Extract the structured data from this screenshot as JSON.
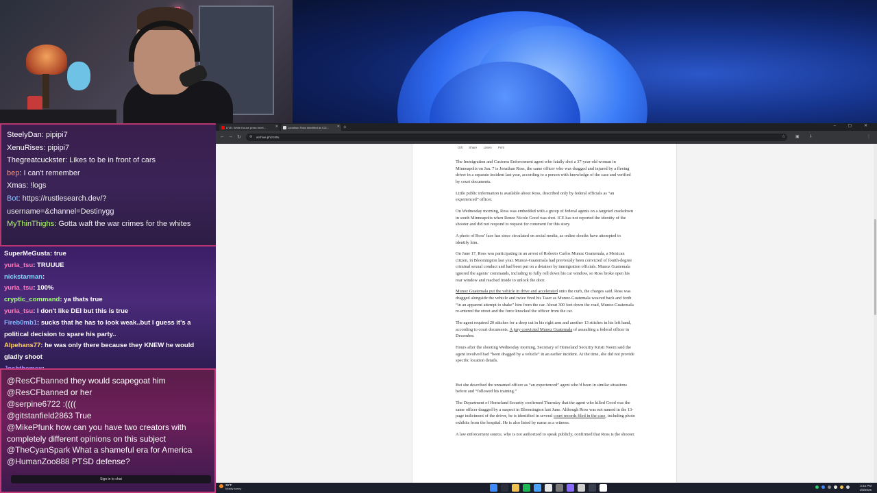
{
  "chat_top": {
    "messages": [
      {
        "user": "SteelyDan",
        "text": ": pipipi7",
        "user_color": "#ffffff"
      },
      {
        "user": "XenuRises",
        "text": ": pipipi7",
        "user_color": "#ffffff"
      },
      {
        "user": "Thegreatcuckster",
        "text": ": Likes to be in front of cars",
        "user_color": "#ffffff"
      },
      {
        "user": "bep",
        "text": ": I can't remember",
        "user_color": "#ff8f6b"
      },
      {
        "user": "Xmas",
        "text": ": !logs",
        "user_color": "#ffffff"
      },
      {
        "user": "Bot",
        "text": ": https://rustlesearch.dev/?",
        "user_color": "#8fc3ff"
      },
      {
        "user": "",
        "text": "username=&channel=Destinygg",
        "user_color": "#ffffff"
      },
      {
        "user": "MyThinThighs",
        "text": ": Gotta waft the war crimes for the whites",
        "user_color": "#b2ff6b"
      }
    ]
  },
  "chat_mid": {
    "messages": [
      {
        "user": "SuperMeGusta",
        "text": ": true",
        "user_color": "#ffffff"
      },
      {
        "user": "yuria_tsu",
        "text": ": TRUUUE",
        "user_color": "#ff7ab8"
      },
      {
        "user": "nickstarman",
        "text": ":",
        "user_color": "#7fd9ff"
      },
      {
        "user": "yuria_tsu",
        "text": ": 100%",
        "user_color": "#ff7ab8"
      },
      {
        "user": "cryptic_command",
        "text": ": ya thats true",
        "user_color": "#a8ff7a"
      },
      {
        "user": "yuria_tsu",
        "text": ": I don't like DEI but this is true",
        "user_color": "#ff7ab8"
      },
      {
        "user": "Fireb0mb1",
        "text": ": sucks that he has to look weak..but I guess it's a political decision to spare his party..",
        "user_color": "#7fb8ff"
      },
      {
        "user": "Alpehans77",
        "text": ": he was only there because they KNEW he would gladly shoot",
        "user_color": "#ffd36b"
      },
      {
        "user": "Joshthemex",
        "text": ":",
        "user_color": "#b08cff"
      }
    ]
  },
  "chat_bottom": {
    "messages": [
      {
        "user": "@ResCFbanned",
        "text": " they would scapegoat him"
      },
      {
        "user": "@ResCFbanned",
        "text": " or her"
      },
      {
        "user": "@serpine6722",
        "text": " :(((("
      },
      {
        "user": "@gitstanfield2863",
        "text": " True"
      },
      {
        "user": "@MikePfunk",
        "text": " how can you have two creators with completely different opinions on this subject"
      },
      {
        "user": "@TheCyanSpark",
        "text": " What a shameful era for America"
      },
      {
        "user": "@HumanZoo888",
        "text": " PTSD defense?"
      }
    ],
    "sign_in_label": "Sign in to chat"
  },
  "browser": {
    "tabs": [
      {
        "label": "LIVE: White House press briefi...",
        "favicon_color": "#ff0000"
      },
      {
        "label": "Jonathan Ross identified as ICE...",
        "favicon_color": "#dddddd"
      }
    ],
    "new_tab": "+",
    "window_controls": "– ▢ ✕",
    "nav": {
      "back": "←",
      "forward": "→",
      "reload": "↻"
    },
    "url": "archive.ph/zJ45L",
    "toolbar_icons": [
      "☆",
      "▣",
      "⇩",
      "⋮"
    ]
  },
  "article": {
    "actions": [
      "Gift",
      "Share",
      "Listen",
      "Print"
    ],
    "paragraphs": [
      {
        "pre": "The Immigration and Customs Enforcement agent who fatally shot a 37-year-old woman in Minneapolis on Jan. 7 is Jonathan Ross, the same officer who was dragged and injured by a fleeing driver in a separate incident last year, according to a person with knowledge of the case and verified by court documents.",
        "link": "",
        "post": ""
      },
      {
        "pre": "Little public information is available about Ross, described only by federal officials as “an experienced” officer.",
        "link": "",
        "post": ""
      },
      {
        "pre": "On Wednesday morning, Ross was embedded with a group of federal agents on a targeted crackdown in south Minneapolis when Renee Nicole Good was shot. ICE has not reported the identity of the shooter and did not respond to request for comment for this story.",
        "link": "",
        "post": ""
      },
      {
        "pre": "A photo of Ross’ face has since circulated on social media, as online sleuths have attempted to identify him.",
        "link": "",
        "post": ""
      },
      {
        "pre": "On June 17, Ross was participating in an arrest of Roberto Carlos Munoz Guatemala, a Mexican citizen, in Bloomington last year. Munoz-Guatemala had previously been convicted of fourth-degree criminal sexual conduct and had been put on a detainer by immigration officials. Munoz Guatemala ignored the agents’ commands, including to fully roll down his car window, so Ross broke open his rear window and reached inside to unlock the door.",
        "link": "",
        "post": ""
      },
      {
        "pre": "",
        "link": "Munoz Guatemala put the vehicle in drive and accelerated",
        "post": " onto the curb, the charges said. Ross was dragged alongside the vehicle and twice fired his Taser as Munoz-Guatemala weaved back and forth “in an apparent attempt to shake” him from the car. About 300 feet down the road, Munoz-Guatemala re-entered the street and the force knocked the officer from the car."
      },
      {
        "pre": "The agent required 20 stitches for a deep cut in his right arm and another 13 stitches in his left hand, according to court documents. ",
        "link": "A jury convicted Munoz Guatemala",
        "post": " of assaulting a federal officer in December."
      },
      {
        "pre": "Hours after the shooting Wednesday morning, Secretary of Homeland Security Kristi Noem said the agent involved had “been dragged by a vehicle” in an earlier incident. At the time, she did not provide specific location details.",
        "link": "",
        "post": ""
      },
      {
        "pre": "But she described the unnamed officer as “an experienced” agent who’d been in similar situations before and “followed his training.”",
        "link": "",
        "post": ""
      },
      {
        "pre": "The Department of Homeland Security confirmed Thursday that the agent who killed Good was the same officer dragged by a suspect in Bloomington last June. Although Ross was not named in the 13-page indictment of the driver, he is identified in several ",
        "link": "court records filed in the case",
        "post": ", including photo exhibits from the hospital. He is also listed by name as a witness."
      },
      {
        "pre": "A law enforcement source, who is not authorized to speak publicly, confirmed that Ross is the shooter.",
        "link": "",
        "post": ""
      }
    ]
  },
  "taskbar": {
    "weather_temp": "39°F",
    "weather_desc": "Mostly sunny",
    "time": "3:34 PM",
    "date": "1/8/2026",
    "app_colors": [
      "#3d8bff",
      "#2a2f3b",
      "#f2c14e",
      "#1db954",
      "#4aa3ff",
      "#e8e8e8",
      "#7a7a7a",
      "#8a6bff",
      "#cfcfcf",
      "#3a3f4f",
      "#ffffff"
    ],
    "tray_colors": [
      "#2ecc71",
      "#3d8bff",
      "#8a8a8a",
      "#e8e8e8",
      "#f2c14e",
      "#cfcfcf"
    ]
  }
}
